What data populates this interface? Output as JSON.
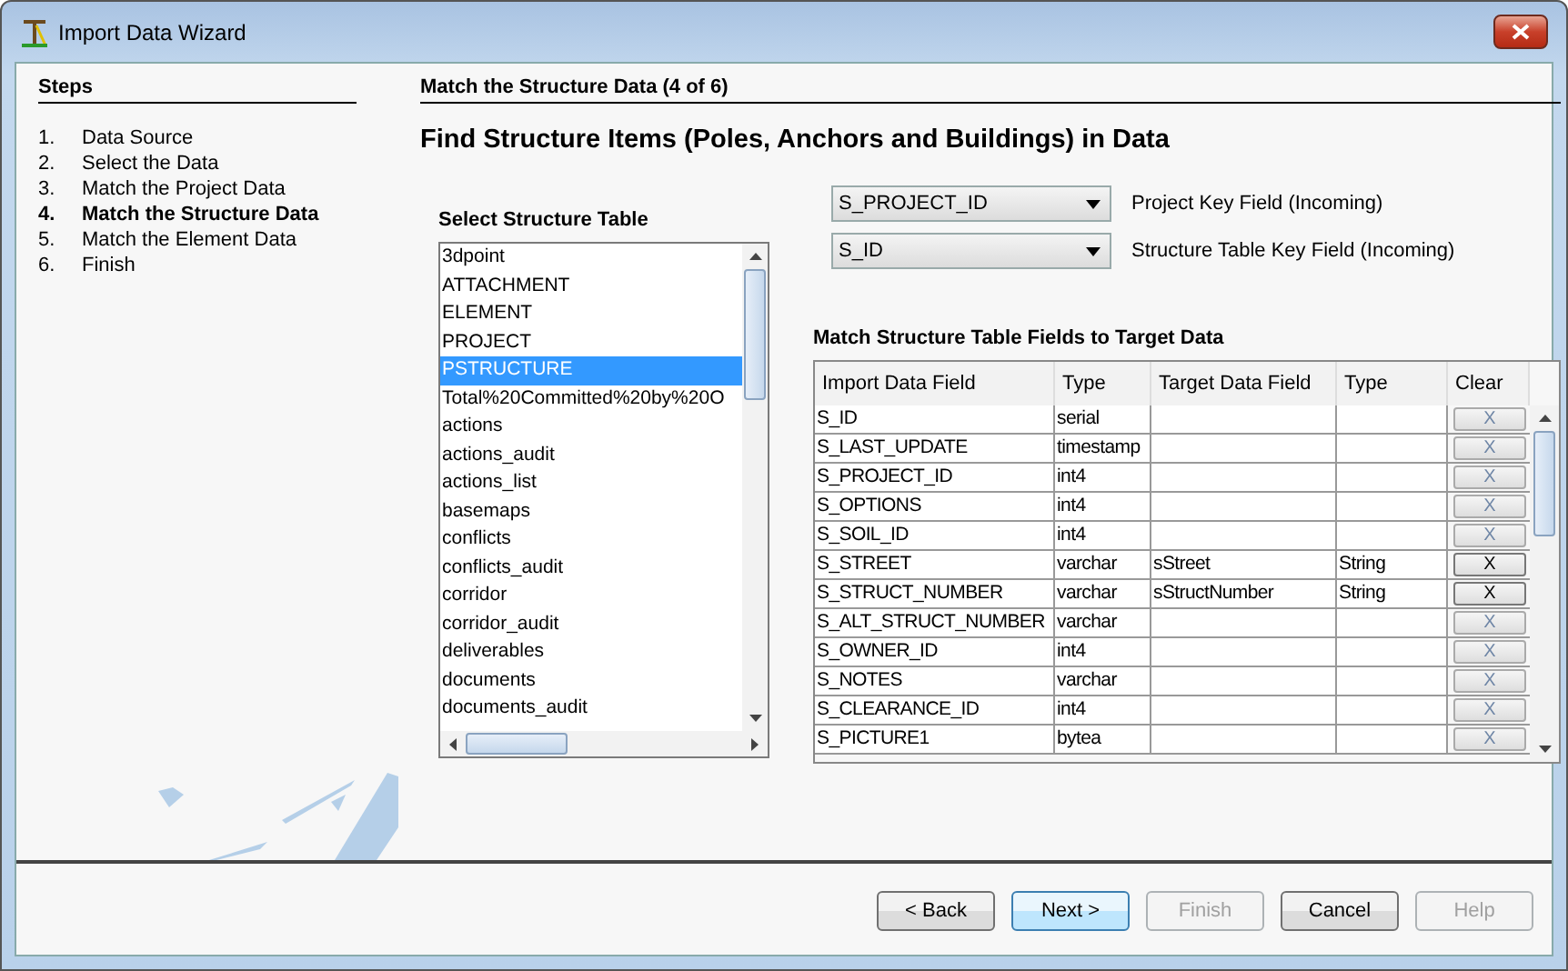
{
  "window": {
    "title": "Import Data Wizard"
  },
  "steps": {
    "title": "Steps",
    "items": [
      {
        "number": "1.",
        "label": "Data Source",
        "selected": false
      },
      {
        "number": "2.",
        "label": "Select the Data",
        "selected": false
      },
      {
        "number": "3.",
        "label": "Match the Project Data",
        "selected": false
      },
      {
        "number": "4.",
        "label": "Match the Structure Data",
        "selected": true
      },
      {
        "number": "5.",
        "label": "Match the Element Data",
        "selected": false
      },
      {
        "number": "6.",
        "label": "Finish",
        "selected": false
      }
    ]
  },
  "page": {
    "title": "Match the Structure Data (4 of 6)",
    "heading": "Find Structure Items (Poles, Anchors and Buildings) in Data"
  },
  "structure_table": {
    "label": "Select Structure Table",
    "items": [
      {
        "label": "3dpoint",
        "selected": false
      },
      {
        "label": "ATTACHMENT",
        "selected": false
      },
      {
        "label": "ELEMENT",
        "selected": false
      },
      {
        "label": "PROJECT",
        "selected": false
      },
      {
        "label": "PSTRUCTURE",
        "selected": true
      },
      {
        "label": "Total%20Committed%20by%20O",
        "selected": false
      },
      {
        "label": "actions",
        "selected": false
      },
      {
        "label": "actions_audit",
        "selected": false
      },
      {
        "label": "actions_list",
        "selected": false
      },
      {
        "label": "basemaps",
        "selected": false
      },
      {
        "label": "conflicts",
        "selected": false
      },
      {
        "label": "conflicts_audit",
        "selected": false
      },
      {
        "label": "corridor",
        "selected": false
      },
      {
        "label": "corridor_audit",
        "selected": false
      },
      {
        "label": "deliverables",
        "selected": false
      },
      {
        "label": "documents",
        "selected": false
      },
      {
        "label": "documents_audit",
        "selected": false
      }
    ]
  },
  "key_fields": [
    {
      "value": "S_PROJECT_ID",
      "label": "Project Key Field (Incoming)"
    },
    {
      "value": "S_ID",
      "label": "Structure Table Key Field (Incoming)"
    }
  ],
  "match_table": {
    "label": "Match Structure Table Fields to Target Data",
    "columns": [
      "Import Data Field",
      "Type",
      "Target Data Field",
      "Type",
      "Clear"
    ],
    "rows": [
      {
        "field": "S_ID",
        "type": "serial",
        "target": "",
        "target_type": "",
        "clear": "X",
        "clear_enabled": false
      },
      {
        "field": "S_LAST_UPDATE",
        "type": "timestamp",
        "target": "",
        "target_type": "",
        "clear": "X",
        "clear_enabled": false
      },
      {
        "field": "S_PROJECT_ID",
        "type": "int4",
        "target": "",
        "target_type": "",
        "clear": "X",
        "clear_enabled": false
      },
      {
        "field": "S_OPTIONS",
        "type": "int4",
        "target": "",
        "target_type": "",
        "clear": "X",
        "clear_enabled": false
      },
      {
        "field": "S_SOIL_ID",
        "type": "int4",
        "target": "",
        "target_type": "",
        "clear": "X",
        "clear_enabled": false
      },
      {
        "field": "S_STREET",
        "type": "varchar",
        "target": "sStreet",
        "target_type": "String",
        "clear": "X",
        "clear_enabled": true
      },
      {
        "field": "S_STRUCT_NUMBER",
        "type": "varchar",
        "target": "sStructNumber",
        "target_type": "String",
        "clear": "X",
        "clear_enabled": true
      },
      {
        "field": "S_ALT_STRUCT_NUMBER",
        "type": "varchar",
        "target": "",
        "target_type": "",
        "clear": "X",
        "clear_enabled": false
      },
      {
        "field": "S_OWNER_ID",
        "type": "int4",
        "target": "",
        "target_type": "",
        "clear": "X",
        "clear_enabled": false
      },
      {
        "field": "S_NOTES",
        "type": "varchar",
        "target": "",
        "target_type": "",
        "clear": "X",
        "clear_enabled": false
      },
      {
        "field": "S_CLEARANCE_ID",
        "type": "int4",
        "target": "",
        "target_type": "",
        "clear": "X",
        "clear_enabled": false
      },
      {
        "field": "S_PICTURE1",
        "type": "bytea",
        "target": "",
        "target_type": "",
        "clear": "X",
        "clear_enabled": false
      }
    ]
  },
  "buttons": [
    {
      "label": "< Back",
      "disabled": false,
      "default": false
    },
    {
      "label": "Next >",
      "disabled": false,
      "default": true
    },
    {
      "label": "Finish",
      "disabled": true,
      "default": false
    },
    {
      "label": "Cancel",
      "disabled": false,
      "default": false
    },
    {
      "label": "Help",
      "disabled": true,
      "default": false
    }
  ]
}
